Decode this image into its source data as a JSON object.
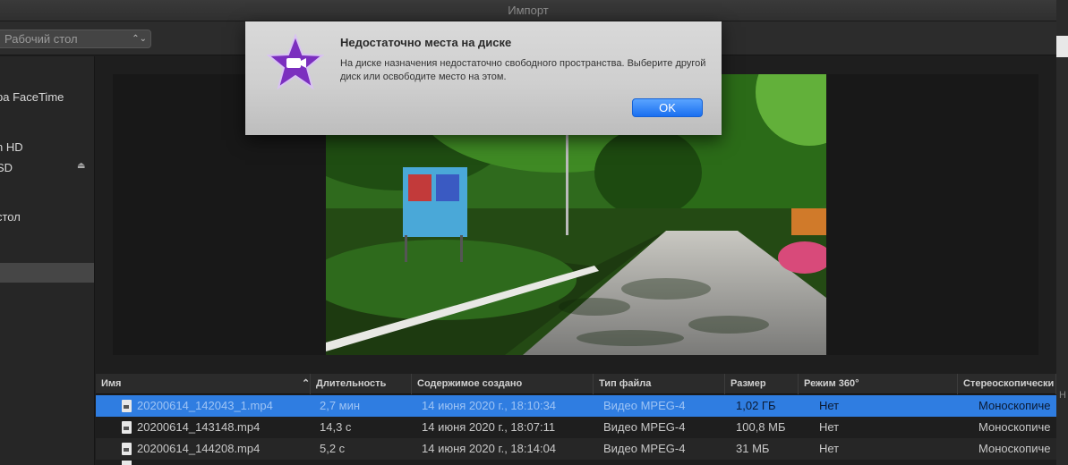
{
  "window": {
    "title": "Импорт"
  },
  "toolbar": {
    "location": "Рабочий стол",
    "location_arrows": "⌃⌄"
  },
  "sidebar": {
    "items": [
      {
        "label": "ра FaceTime"
      },
      {
        "label": "n HD"
      },
      {
        "label": "SD"
      },
      {
        "label": "стол"
      }
    ],
    "eject": "⏏"
  },
  "right_strip": {
    "fragment": "Н"
  },
  "table": {
    "columns": [
      "Имя",
      "Длительность",
      "Содержимое создано",
      "Тип файла",
      "Размер",
      "Режим 360°",
      "Стереоскопически"
    ],
    "sort_indicator": "⌃",
    "rows": [
      {
        "name": "20200614_142043_1.mp4",
        "duration": "2,7 мин",
        "created": "14 июня 2020 г., 18:10:34",
        "type": "Видео MPEG-4",
        "size": "1,02 ГБ",
        "mode360": "Нет",
        "stereo": "Моноскопиче"
      },
      {
        "name": "20200614_143148.mp4",
        "duration": "14,3 с",
        "created": "14 июня 2020 г., 18:07:11",
        "type": "Видео MPEG-4",
        "size": "100,8 МБ",
        "mode360": "Нет",
        "stereo": "Моноскопиче"
      },
      {
        "name": "20200614_144208.mp4",
        "duration": "5,2 с",
        "created": "14 июня 2020 г., 18:14:04",
        "type": "Видео MPEG-4",
        "size": "31 МБ",
        "mode360": "Нет",
        "stereo": "Моноскопиче"
      }
    ]
  },
  "alert": {
    "title": "Недостаточно места на диске",
    "message": "На диске назначения недостаточно свободного пространства. Выберите другой диск или освободите место на этом.",
    "ok_label": "OK"
  },
  "colors": {
    "selection": "#2f7de1",
    "ok_button": "#1a6ff0",
    "imovie_star": "#7b2fbf"
  }
}
